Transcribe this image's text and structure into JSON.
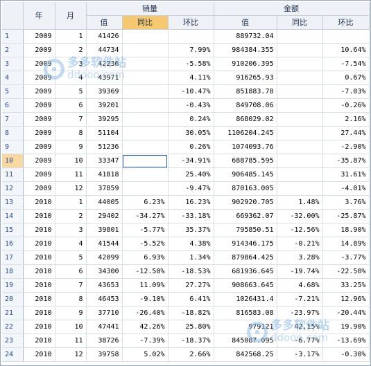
{
  "headers": {
    "year": "年",
    "month": "月",
    "group_volume": "销量",
    "group_amount": "金额",
    "value": "值",
    "yoy": "同比",
    "mom": "环比"
  },
  "rows": [
    {
      "n": "1",
      "y": "2009",
      "m": "1",
      "v": "41426",
      "vy": "",
      "vm": "",
      "a": "889732.04",
      "ay": "",
      "am": ""
    },
    {
      "n": "2",
      "y": "2009",
      "m": "2",
      "v": "44734",
      "vy": "",
      "vm": "7.99%",
      "a": "984384.355",
      "ay": "",
      "am": "10.64%"
    },
    {
      "n": "3",
      "y": "2009",
      "m": "3",
      "v": "42236",
      "vy": "",
      "vm": "-5.58%",
      "a": "910206.395",
      "ay": "",
      "am": "-7.54%"
    },
    {
      "n": "4",
      "y": "2009",
      "m": "4",
      "v": "43971",
      "vy": "",
      "vm": "4.11%",
      "a": "916265.93",
      "ay": "",
      "am": "0.67%"
    },
    {
      "n": "5",
      "y": "2009",
      "m": "5",
      "v": "39369",
      "vy": "",
      "vm": "-10.47%",
      "a": "851883.78",
      "ay": "",
      "am": "-7.03%"
    },
    {
      "n": "6",
      "y": "2009",
      "m": "6",
      "v": "39201",
      "vy": "",
      "vm": "-0.43%",
      "a": "849708.06",
      "ay": "",
      "am": "-0.26%"
    },
    {
      "n": "7",
      "y": "2009",
      "m": "7",
      "v": "39295",
      "vy": "",
      "vm": "0.24%",
      "a": "868029.02",
      "ay": "",
      "am": "2.16%"
    },
    {
      "n": "8",
      "y": "2009",
      "m": "8",
      "v": "51104",
      "vy": "",
      "vm": "30.05%",
      "a": "1106204.245",
      "ay": "",
      "am": "27.44%"
    },
    {
      "n": "9",
      "y": "2009",
      "m": "9",
      "v": "51236",
      "vy": "",
      "vm": "0.26%",
      "a": "1074093.76",
      "ay": "",
      "am": "-2.90%"
    },
    {
      "n": "10",
      "y": "2009",
      "m": "10",
      "v": "33347",
      "vy": "",
      "vm": "-34.91%",
      "a": "688785.595",
      "ay": "",
      "am": "-35.87%"
    },
    {
      "n": "11",
      "y": "2009",
      "m": "11",
      "v": "41818",
      "vy": "",
      "vm": "25.40%",
      "a": "906485.145",
      "ay": "",
      "am": "31.61%"
    },
    {
      "n": "12",
      "y": "2009",
      "m": "12",
      "v": "37859",
      "vy": "",
      "vm": "-9.47%",
      "a": "870163.005",
      "ay": "",
      "am": "-4.01%"
    },
    {
      "n": "13",
      "y": "2010",
      "m": "1",
      "v": "44005",
      "vy": "6.23%",
      "vm": "16.23%",
      "a": "902920.705",
      "ay": "1.48%",
      "am": "3.76%"
    },
    {
      "n": "14",
      "y": "2010",
      "m": "2",
      "v": "29402",
      "vy": "-34.27%",
      "vm": "-33.18%",
      "a": "669362.07",
      "ay": "-32.00%",
      "am": "-25.87%"
    },
    {
      "n": "15",
      "y": "2010",
      "m": "3",
      "v": "39801",
      "vy": "-5.77%",
      "vm": "35.37%",
      "a": "795850.51",
      "ay": "-12.56%",
      "am": "18.90%"
    },
    {
      "n": "16",
      "y": "2010",
      "m": "4",
      "v": "41544",
      "vy": "-5.52%",
      "vm": "4.38%",
      "a": "914346.175",
      "ay": "-0.21%",
      "am": "14.89%"
    },
    {
      "n": "17",
      "y": "2010",
      "m": "5",
      "v": "42099",
      "vy": "6.93%",
      "vm": "1.34%",
      "a": "879864.425",
      "ay": "3.28%",
      "am": "-3.77%"
    },
    {
      "n": "18",
      "y": "2010",
      "m": "6",
      "v": "34300",
      "vy": "-12.50%",
      "vm": "-18.53%",
      "a": "681936.645",
      "ay": "-19.74%",
      "am": "-22.50%"
    },
    {
      "n": "19",
      "y": "2010",
      "m": "7",
      "v": "43653",
      "vy": "11.09%",
      "vm": "27.27%",
      "a": "908663.645",
      "ay": "4.68%",
      "am": "33.25%"
    },
    {
      "n": "20",
      "y": "2010",
      "m": "8",
      "v": "46453",
      "vy": "-9.10%",
      "vm": "6.41%",
      "a": "1026431.4",
      "ay": "-7.21%",
      "am": "12.96%"
    },
    {
      "n": "21",
      "y": "2010",
      "m": "9",
      "v": "37710",
      "vy": "-26.40%",
      "vm": "-18.82%",
      "a": "816583.08",
      "ay": "-23.97%",
      "am": "-20.44%"
    },
    {
      "n": "22",
      "y": "2010",
      "m": "10",
      "v": "47441",
      "vy": "42.26%",
      "vm": "25.80%",
      "a": "979121",
      "ay": "42.15%",
      "am": "19.90%"
    },
    {
      "n": "23",
      "y": "2010",
      "m": "11",
      "v": "38726",
      "vy": "-7.39%",
      "vm": "-18.37%",
      "a": "845087.095",
      "ay": "-6.77%",
      "am": "-13.69%"
    },
    {
      "n": "24",
      "y": "2010",
      "m": "12",
      "v": "39758",
      "vy": "5.02%",
      "vm": "2.66%",
      "a": "842568.25",
      "ay": "-3.17%",
      "am": "-0.30%"
    }
  ],
  "active_row": "10",
  "watermark": {
    "cn": "多多软件站",
    "url": "ddooo.com"
  }
}
